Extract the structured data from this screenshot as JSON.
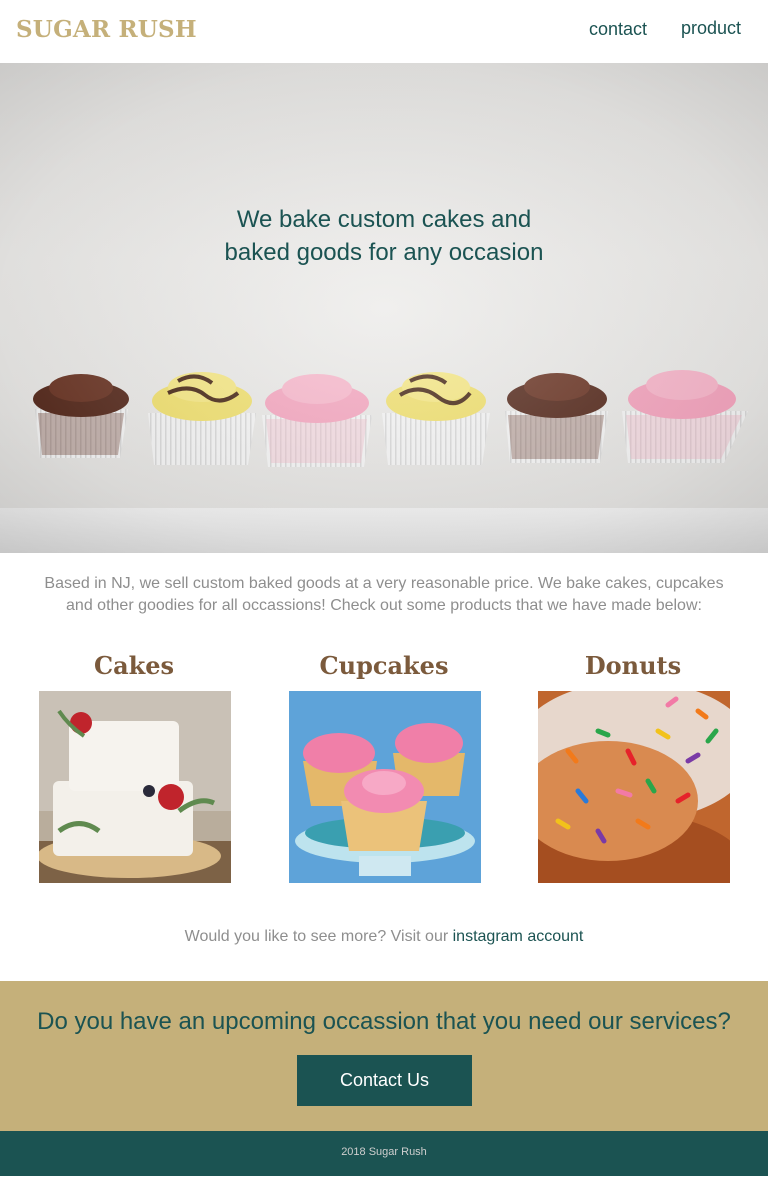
{
  "header": {
    "logo": "SUGAR RUSH",
    "nav": [
      {
        "label": "contact"
      },
      {
        "label": "product"
      }
    ]
  },
  "hero": {
    "line1": "We bake custom cakes and",
    "line2": "baked goods for any occasion"
  },
  "intro": "Based in NJ, we sell custom baked goods at a very reasonable price. We bake cakes, cupcakes and other goodies for all occassions! Check out some products that we have made below:",
  "products": [
    {
      "title": "Cakes"
    },
    {
      "title": "Cupcakes"
    },
    {
      "title": "Donuts"
    }
  ],
  "more": {
    "text": "Would you like to see more? Visit our ",
    "link": "instagram account"
  },
  "cta": {
    "title": "Do you have an upcoming occassion that you need our services?",
    "button": "Contact Us"
  },
  "footer": {
    "text": "2018 Sugar Rush"
  },
  "colors": {
    "gold": "#c5b07a",
    "teal": "#1b5352",
    "brown": "#7b5a3c",
    "gray_text": "#8e8e8e"
  }
}
